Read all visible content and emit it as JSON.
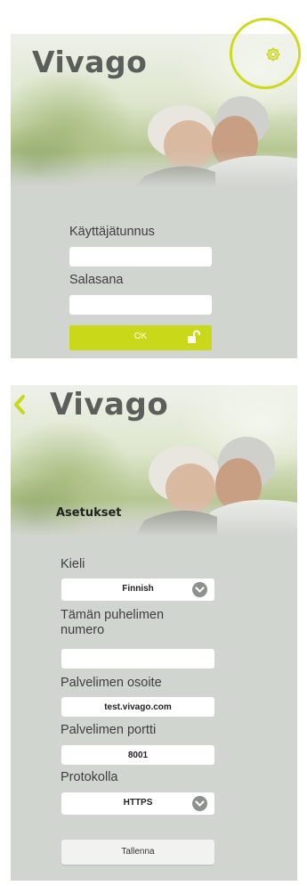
{
  "login": {
    "brand": "Vivago",
    "username_label": "Käyttäjätunnus",
    "username_value": "",
    "password_label": "Salasana",
    "password_value": "",
    "ok_label": "OK",
    "icons": {
      "settings": "gear-icon",
      "lock": "unlock-icon"
    },
    "highlight_color": "#cfd91c"
  },
  "settings": {
    "brand": "Vivago",
    "title": "Asetukset",
    "language_label": "Kieli",
    "language_value": "Finnish",
    "phone_label": "Tämän puhelimen numero",
    "phone_value": "",
    "server_address_label": "Palvelimen osoite",
    "server_address_value": "test.vivago.com",
    "server_port_label": "Palvelimen portti",
    "server_port_value": "8001",
    "protocol_label": "Protokolla",
    "protocol_value": "HTTPS",
    "save_label": "Tallenna",
    "icons": {
      "back": "chevron-left-icon",
      "dropdown": "chevron-down-icon"
    }
  },
  "colors": {
    "accent": "#c9d91a",
    "panel": "#d1d5cf",
    "brand_text": "#5a5f5c"
  }
}
